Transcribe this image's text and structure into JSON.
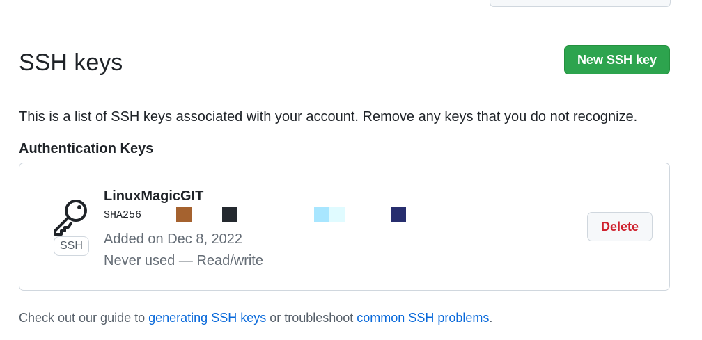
{
  "header": {
    "title": "SSH keys",
    "new_button_label": "New SSH key"
  },
  "description": "This is a list of SSH keys associated with your account. Remove any keys that you do not recognize.",
  "auth_section": {
    "heading": "Authentication Keys",
    "keys": [
      {
        "title": "LinuxMagicGIT",
        "fingerprint_label": "SHA256",
        "badge": "SSH",
        "added": "Added on Dec 8, 2022",
        "usage": "Never used — Read/write",
        "delete_label": "Delete",
        "icon": "key-icon"
      }
    ]
  },
  "footer": {
    "prefix": "Check out our guide to ",
    "link1": "generating SSH keys",
    "middle": " or troubleshoot ",
    "link2": "common SSH problems",
    "suffix": "."
  },
  "colors": {
    "primary_button": "#2da44e",
    "danger_text": "#cf222e",
    "link": "#0969da",
    "redaction_blocks": [
      "#a5622f",
      "#24292f",
      "#a8e6ff",
      "#e0fbff",
      "#272e6e"
    ]
  }
}
